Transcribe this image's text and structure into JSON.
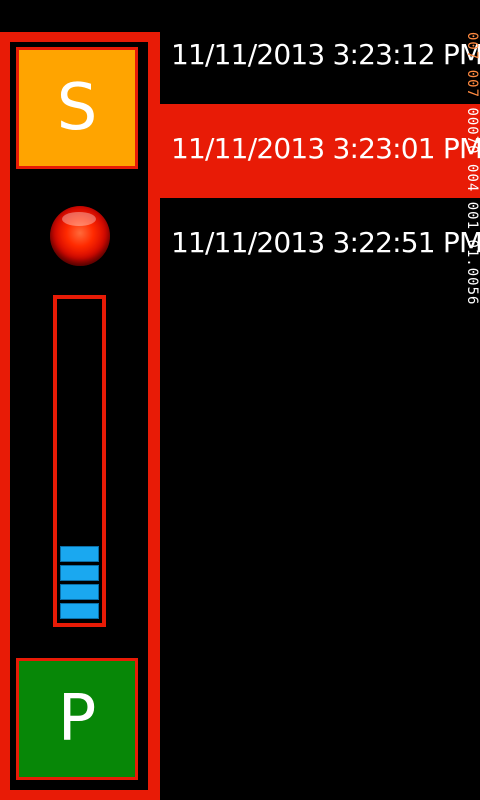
{
  "controls": {
    "start_label": "S",
    "pause_label": "P"
  },
  "status_light": {
    "state": "on",
    "color": "#ff2a00"
  },
  "level_meter": {
    "filled_cells": 4,
    "cell_color": "#1aa8f0"
  },
  "timestamps": [
    {
      "text": "11/11/2013 3:23:12 PM",
      "selected": false
    },
    {
      "text": "11/11/2013 3:23:01 PM",
      "selected": true
    },
    {
      "text": "11/11/2013 3:22:51 PM",
      "selected": false
    }
  ],
  "readout": {
    "accent_text": "007 007 ",
    "plain_text": "00070 004 001 01.0056"
  },
  "colors": {
    "accent": "#e81b06",
    "start": "#ffa400",
    "pause": "#078707"
  }
}
